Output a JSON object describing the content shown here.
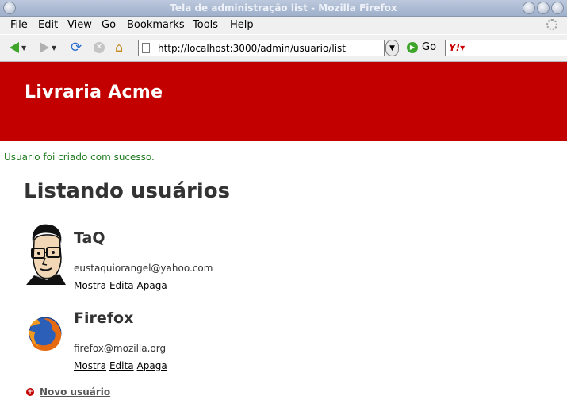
{
  "window": {
    "title": "Tela de administração list - Mozilla Firefox"
  },
  "menu": [
    "File",
    "Edit",
    "View",
    "Go",
    "Bookmarks",
    "Tools",
    "Help"
  ],
  "toolbar": {
    "url": "http://localhost:3000/admin/usuario/list",
    "go_label": "Go",
    "search_engine_icon": "yahoo-icon"
  },
  "page": {
    "brand": "Livraria Acme",
    "flash": "Usuario foi criado com sucesso.",
    "title": "Listando usuários",
    "users": [
      {
        "name": "TaQ",
        "email": "eustaquiorangel@yahoo.com",
        "avatar": "cartoon-face-avatar"
      },
      {
        "name": "Firefox",
        "email": "firefox@mozilla.org",
        "avatar": "firefox-logo-avatar"
      }
    ],
    "actions": {
      "show": "Mostra",
      "edit": "Edita",
      "delete": "Apaga"
    },
    "new_user": "Novo usuário"
  },
  "colors": {
    "header_bg": "#c20000",
    "flash_text": "#1f7a1f",
    "heading_text": "#333333"
  }
}
